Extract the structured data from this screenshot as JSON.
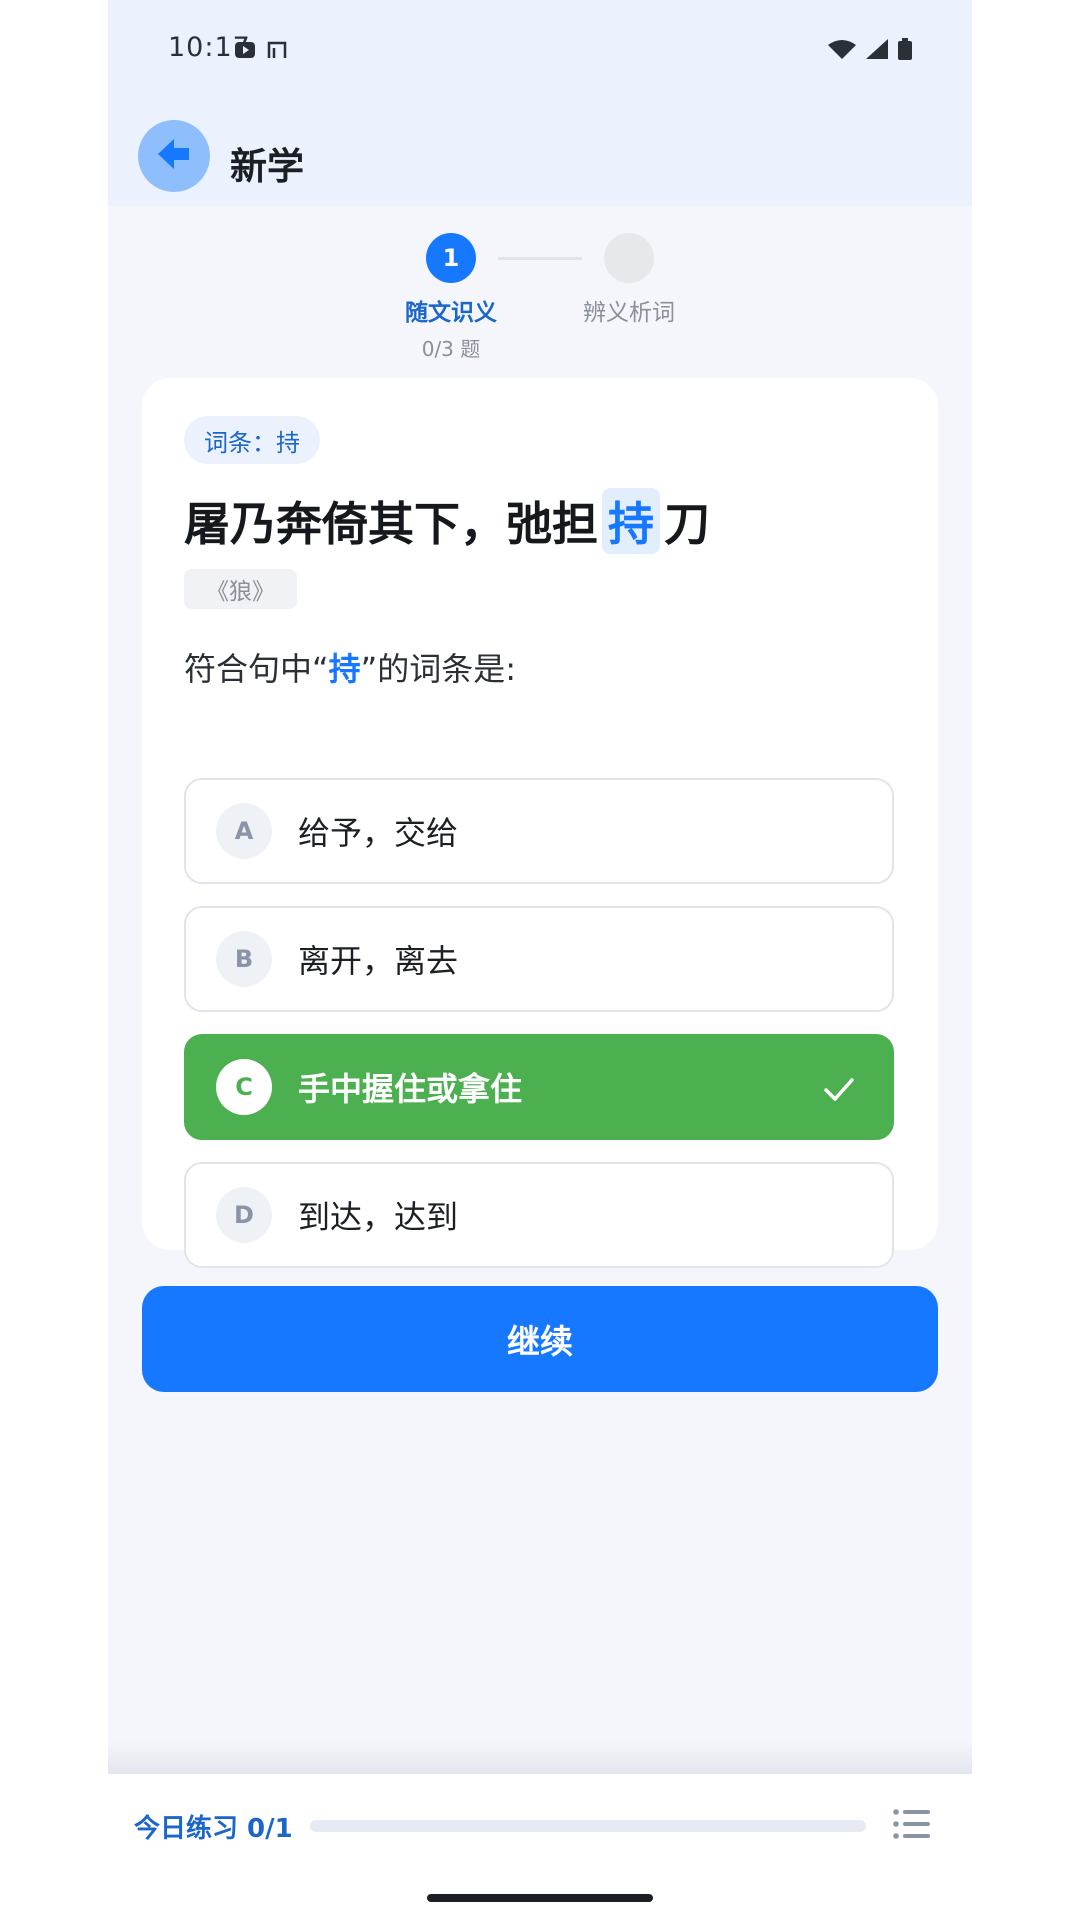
{
  "status_bar": {
    "time": "10:17"
  },
  "header": {
    "back_icon": "arrow-left-icon",
    "title": "新学"
  },
  "stepper": {
    "steps": [
      {
        "number": "1",
        "label": "随文识义",
        "count": "0/3 题",
        "active": true
      },
      {
        "number": "",
        "label": "辨义析词",
        "active": false
      }
    ]
  },
  "question": {
    "tag": "词条：持",
    "sentence_before": "屠乃奔倚其下，弛担",
    "sentence_highlight": "持",
    "sentence_after": "刀",
    "source": "《狼》",
    "prompt_before": "符合句中“",
    "prompt_highlight": "持",
    "prompt_after": "”的词条是:",
    "options": [
      {
        "letter": "A",
        "text": "给予，交给",
        "state": "normal"
      },
      {
        "letter": "B",
        "text": "离开，离去",
        "state": "normal"
      },
      {
        "letter": "C",
        "text": "手中握住或拿住",
        "state": "correct"
      },
      {
        "letter": "D",
        "text": "到达，达到",
        "state": "normal"
      }
    ]
  },
  "continue_label": "继续",
  "footer": {
    "practice_label": "今日练习 0/1",
    "progress": 0,
    "list_icon": "list-icon"
  },
  "colors": {
    "primary": "#1677ff",
    "correct": "#4caf50",
    "header_bg": "#ebf2fe",
    "page_bg": "#f4f6fb"
  }
}
